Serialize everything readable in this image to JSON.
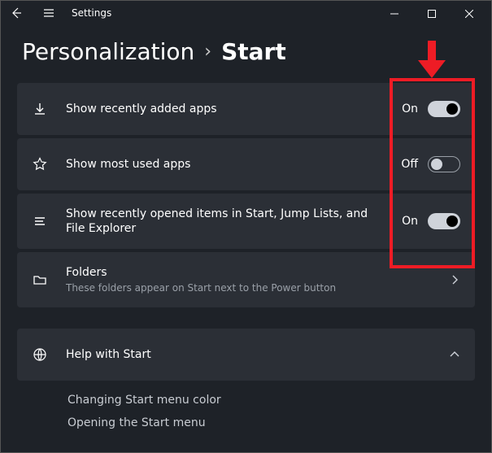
{
  "window": {
    "title": "Settings"
  },
  "breadcrumb": {
    "parent": "Personalization",
    "sep": "›",
    "current": "Start"
  },
  "rows": {
    "recent_apps": {
      "label": "Show recently added apps",
      "state_label": "On",
      "state": "on"
    },
    "most_used": {
      "label": "Show most used apps",
      "state_label": "Off",
      "state": "off"
    },
    "recent_items": {
      "label": "Show recently opened items in Start, Jump Lists, and File Explorer",
      "state_label": "On",
      "state": "on"
    },
    "folders": {
      "title": "Folders",
      "sub": "These folders appear on Start next to the Power button"
    }
  },
  "help": {
    "title": "Help with Start",
    "items": [
      "Changing Start menu color",
      "Opening the Start menu"
    ]
  },
  "annotation": {
    "color": "#ee1c25"
  }
}
